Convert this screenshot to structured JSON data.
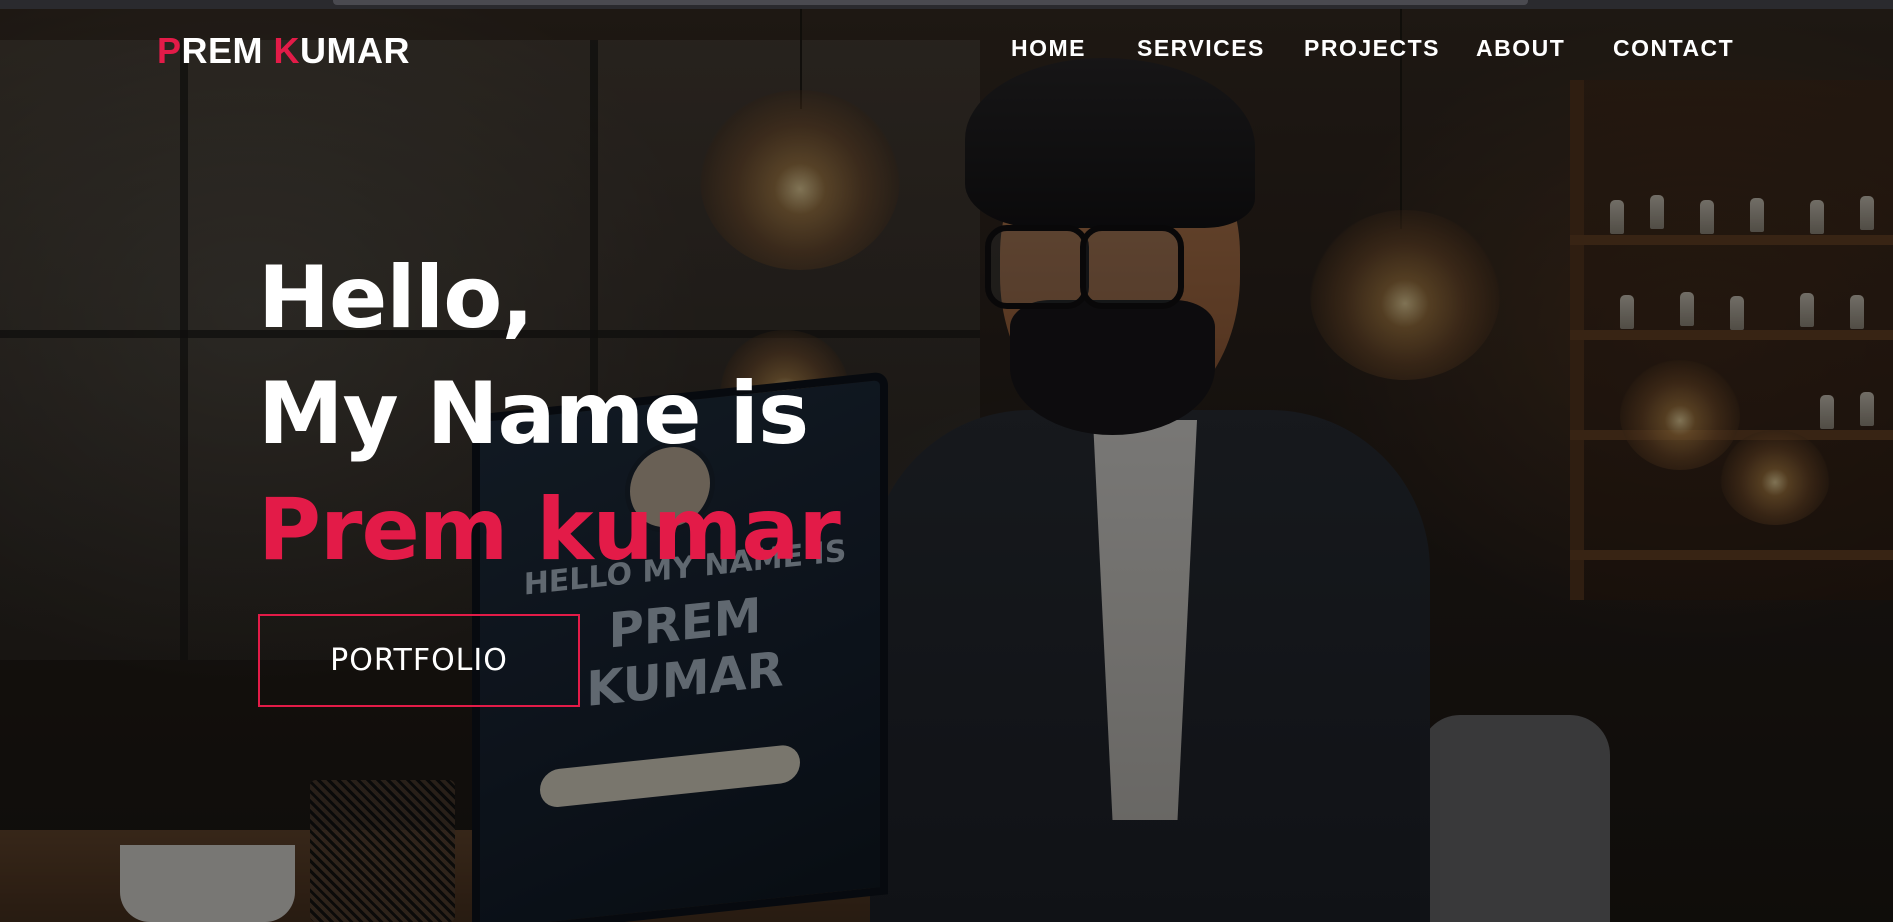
{
  "logo": {
    "first_initial": "P",
    "first_rest": "REM ",
    "last_initial": "K",
    "last_rest": "UMAR"
  },
  "nav": {
    "items": [
      {
        "label": "HOME"
      },
      {
        "label": "SERVICES"
      },
      {
        "label": "PROJECTS"
      },
      {
        "label": "ABOUT"
      },
      {
        "label": "CONTACT"
      }
    ]
  },
  "hero": {
    "line1": "Hello,",
    "line2": "My Name is",
    "name": "Prem kumar",
    "button_label": "PORTFOLIO"
  },
  "illustration": {
    "laptop_line1": "HELLO MY NAME IS",
    "laptop_line2": "PREM KUMAR"
  },
  "colors": {
    "accent": "#e31b48",
    "text": "#ffffff",
    "overlay": "rgba(0,0,0,0.48)"
  }
}
